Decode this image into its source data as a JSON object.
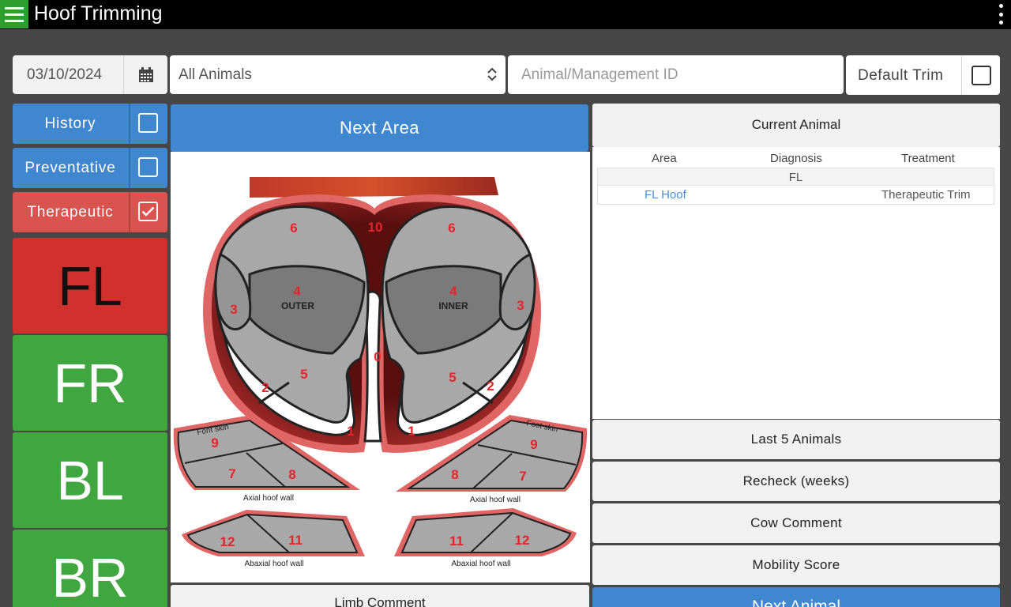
{
  "appbar": {
    "title": "Hoof Trimming",
    "menu_icon": "hamburger-icon",
    "more_icon": "kebab-icon"
  },
  "filters": {
    "date": "03/10/2024",
    "animal_group": "All Animals",
    "animal_id_placeholder": "Animal/Management ID",
    "default_trim_label": "Default Trim",
    "default_trim_checked": false
  },
  "categories": [
    {
      "label": "History",
      "checked": false
    },
    {
      "label": "Preventative",
      "checked": false
    },
    {
      "label": "Therapeutic",
      "checked": true
    }
  ],
  "limbs": [
    {
      "label": "FL",
      "active": true
    },
    {
      "label": "FR",
      "active": false
    },
    {
      "label": "BL",
      "active": false
    },
    {
      "label": "BR",
      "active": false
    }
  ],
  "center": {
    "next_area_label": "Next Area",
    "limb_comment_label": "Limb Comment"
  },
  "diagram": {
    "zones": {
      "z10": "10",
      "z6l": "6",
      "z6r": "6",
      "z4l": "4",
      "z4r": "4",
      "outer": "OUTER",
      "inner": "INNER",
      "z3l": "3",
      "z3r": "3",
      "z0": "0",
      "z5l": "5",
      "z5r": "5",
      "z2l": "2",
      "z2r": "2",
      "z1l": "1",
      "z1r": "1"
    },
    "axial_left": {
      "foot_skin": "Font skin",
      "z9": "9",
      "z7": "7",
      "z8": "8",
      "caption": "Axial hoof wall"
    },
    "axial_right": {
      "foot_skin": "Foot skin",
      "z9": "9",
      "z8": "8",
      "z7": "7",
      "caption": "Axial hoof wall"
    },
    "abaxial_left": {
      "z12": "12",
      "z11": "11",
      "caption": "Abaxial hoof wall"
    },
    "abaxial_right": {
      "z11": "11",
      "z12": "12",
      "caption": "Abaxial hoof wall"
    }
  },
  "current_animal": {
    "title": "Current Animal",
    "columns": [
      "Area",
      "Diagnosis",
      "Treatment"
    ],
    "group": "FL",
    "entries": [
      {
        "area": "FL Hoof",
        "diagnosis": "",
        "treatment": "Therapeutic Trim"
      }
    ]
  },
  "right_buttons": [
    "Last 5 Animals",
    "Recheck (weeks)",
    "Cow Comment",
    "Mobility Score"
  ],
  "next_animal_label": "Next Animal",
  "colors": {
    "accent_blue": "#3f87ce",
    "limb_red": "#d0312d",
    "limb_green": "#40a640",
    "category_red": "#d9534f",
    "menu_green": "#2e9e2e"
  }
}
